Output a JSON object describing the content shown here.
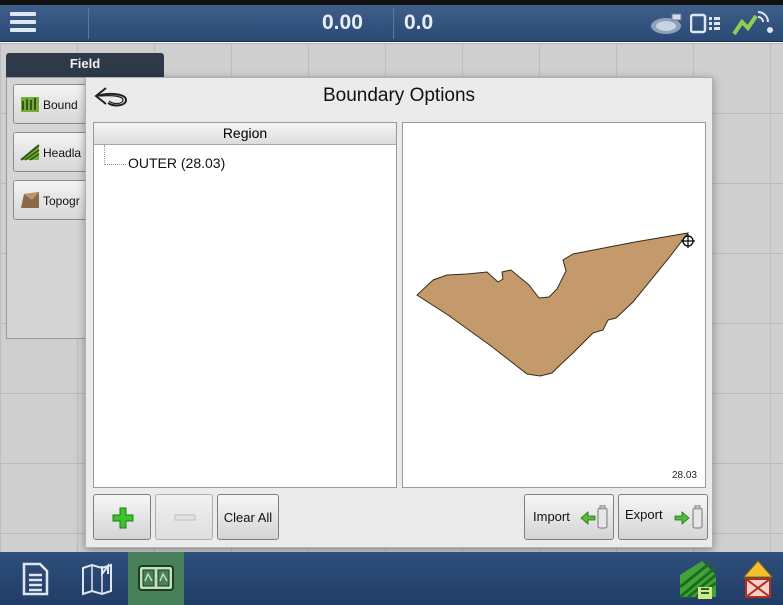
{
  "topbar": {
    "readout_left": "0.00",
    "readout_right": "0.0",
    "icons": [
      "menu-icon",
      "gps-satellite-icon",
      "device-status-icon",
      "wireless-signal-icon"
    ]
  },
  "field_panel": {
    "tab_label": "Field",
    "buttons": [
      {
        "label": "Bound",
        "icon": "boundary-icon"
      },
      {
        "label": "Headla",
        "icon": "headland-icon"
      },
      {
        "label": "Topogr",
        "icon": "topography-icon"
      }
    ]
  },
  "dialog": {
    "title": "Boundary Options",
    "region_header": "Region",
    "regions": [
      {
        "label": "OUTER (28.03)"
      }
    ],
    "preview_acreage": "28.03",
    "buttons": {
      "add": "+",
      "remove": "−",
      "clear_all": "Clear All",
      "import": "Import",
      "export": "Export"
    }
  },
  "colors": {
    "boundary_fill": "#c49a6c",
    "topbar": "#2f4f7c",
    "add_icon": "#3cc22e"
  },
  "bottombar": {
    "icons": [
      "report-icon",
      "field-map-icon",
      "map-layers-icon",
      "field-operations-icon",
      "warning-icon"
    ]
  }
}
